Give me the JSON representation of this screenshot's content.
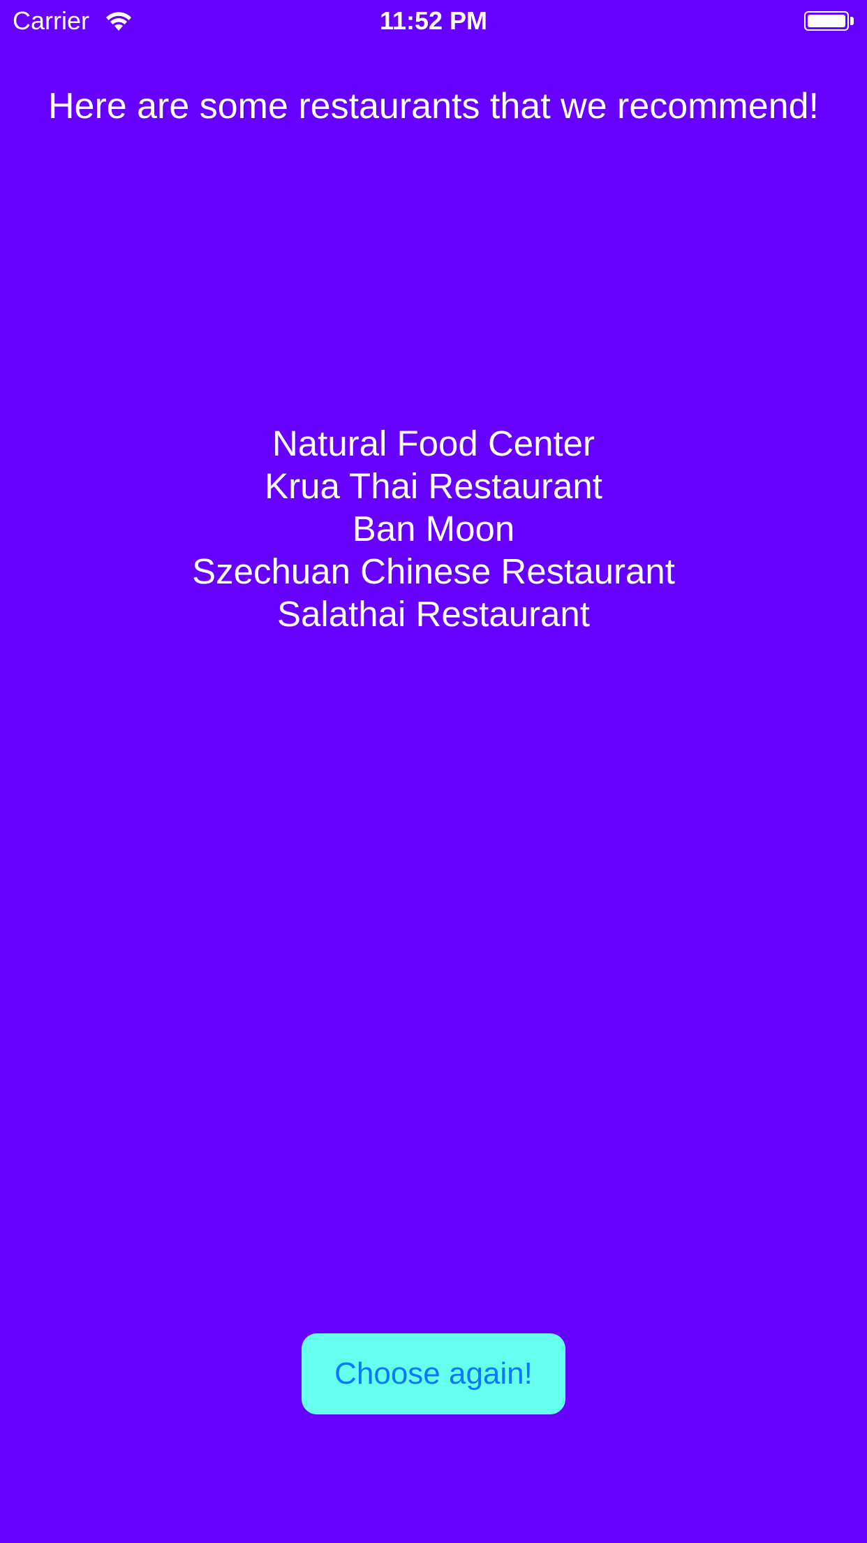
{
  "status_bar": {
    "carrier": "Carrier",
    "time": "11:52 PM",
    "wifi_icon": "wifi-icon",
    "battery_icon": "battery-icon",
    "battery_level": 1.0
  },
  "main": {
    "heading": "Here are some restaurants that we recommend!",
    "restaurants": [
      "Natural Food Center",
      "Krua Thai Restaurant",
      "Ban Moon",
      "Szechuan Chinese Restaurant",
      "Salathai Restaurant"
    ],
    "choose_again_label": "Choose again!"
  },
  "colors": {
    "background": "#6600ff",
    "button_background": "#66ffee",
    "button_text": "#0a77ff",
    "text": "#ffffff"
  }
}
